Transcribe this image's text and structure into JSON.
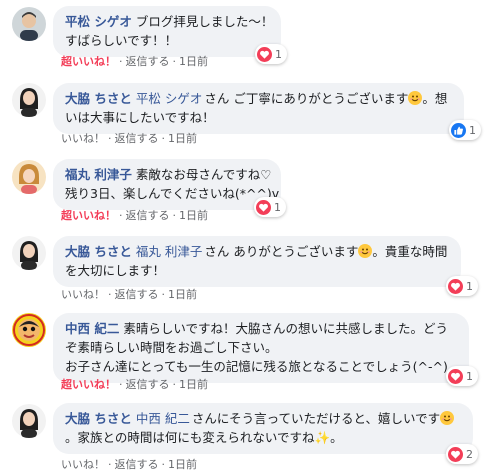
{
  "comments": [
    {
      "author": "平松 シゲオ",
      "lines": [
        "ブログ拝見しました〜！",
        "すばらしいです！！"
      ],
      "actions": {
        "like": "超いいね！",
        "reply": "返信する",
        "time": "1日前"
      },
      "reaction": {
        "type": "heart",
        "count": "1"
      }
    },
    {
      "author": "大脇 ちさと",
      "mention": "平松 シゲオ",
      "lines": [
        "さん ご丁寧にありがとうございます",
        "。想",
        "いは大事にしたいですね！"
      ],
      "actions": {
        "like": "いいね！",
        "reply": "返信する",
        "time": "1日前"
      },
      "reaction": {
        "type": "like",
        "count": "1"
      }
    },
    {
      "author": "福丸 利津子",
      "lines": [
        "素敵なお母さんですね♡",
        "残り3日、楽しんでくださいね(*^^)v"
      ],
      "actions": {
        "like": "超いいね！",
        "reply": "返信する",
        "time": "1日前"
      },
      "reaction": {
        "type": "heart",
        "count": "1"
      }
    },
    {
      "author": "大脇 ちさと",
      "mention": "福丸 利津子",
      "lines": [
        "さん ありがとうございます",
        "。貴重な時間",
        "を大切にします！"
      ],
      "actions": {
        "like": "いいね！",
        "reply": "返信する",
        "time": "1日前"
      },
      "reaction": {
        "type": "heart",
        "count": "1"
      }
    },
    {
      "author": "中西 紀二",
      "lines": [
        "素晴らしいですね！大脇さんの想いに共感しました。どう",
        "ぞ素晴らしい時間をお過ごし下さい。",
        "お子さん達にとっても一生の記憶に残る旅となることでしょう(^-^)"
      ],
      "actions": {
        "like": "超いいね！",
        "reply": "返信する",
        "time": "1日前"
      },
      "reaction": {
        "type": "heart",
        "count": "1"
      }
    },
    {
      "author": "大脇 ちさと",
      "mention": "中西 紀二",
      "lines": [
        "さんにそう言っていただけると、嬉しいです",
        "。家族との時間は何にも変えられないですね",
        "。"
      ],
      "actions": {
        "like": "いいね！",
        "reply": "返信する",
        "time": "1日前"
      },
      "reaction": {
        "type": "heart",
        "count": "2"
      }
    }
  ],
  "separator": "·",
  "colors": {
    "name": "#385898",
    "super_like": "#f33e58",
    "bubble": "#f0f2f5",
    "meta": "#65676b",
    "like_blue": "#1877f2"
  }
}
